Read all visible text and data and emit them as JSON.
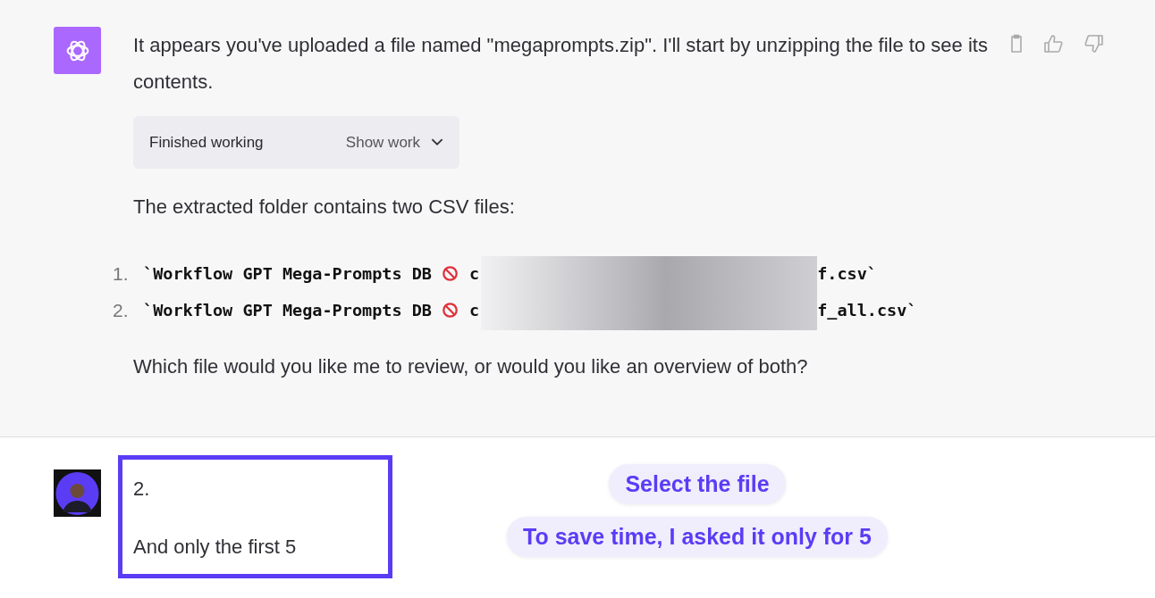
{
  "assistant_message": {
    "intro": "It appears you've uploaded a file named \"megaprompts.zip\". I'll start by unzipping the file to see its contents.",
    "work_status": {
      "label": "Finished working",
      "toggle": "Show work",
      "expanded": false
    },
    "lead": "The extracted folder contains two CSV files:",
    "files": [
      {
        "number": "1.",
        "name_start": "`Workflow GPT Mega-Prompts DB",
        "name_mid": "c",
        "name_end": "f.csv`"
      },
      {
        "number": "2.",
        "name_start": "`Workflow GPT Mega-Prompts DB",
        "name_mid": "c",
        "name_end": "f_all.csv`"
      }
    ],
    "question": "Which file would you like me to review, or would you like an overview of both?"
  },
  "user_message": {
    "lines": [
      "2.",
      "And only the first 5"
    ]
  },
  "annotations": [
    "Select the file",
    "To save time, I asked it only for 5"
  ]
}
